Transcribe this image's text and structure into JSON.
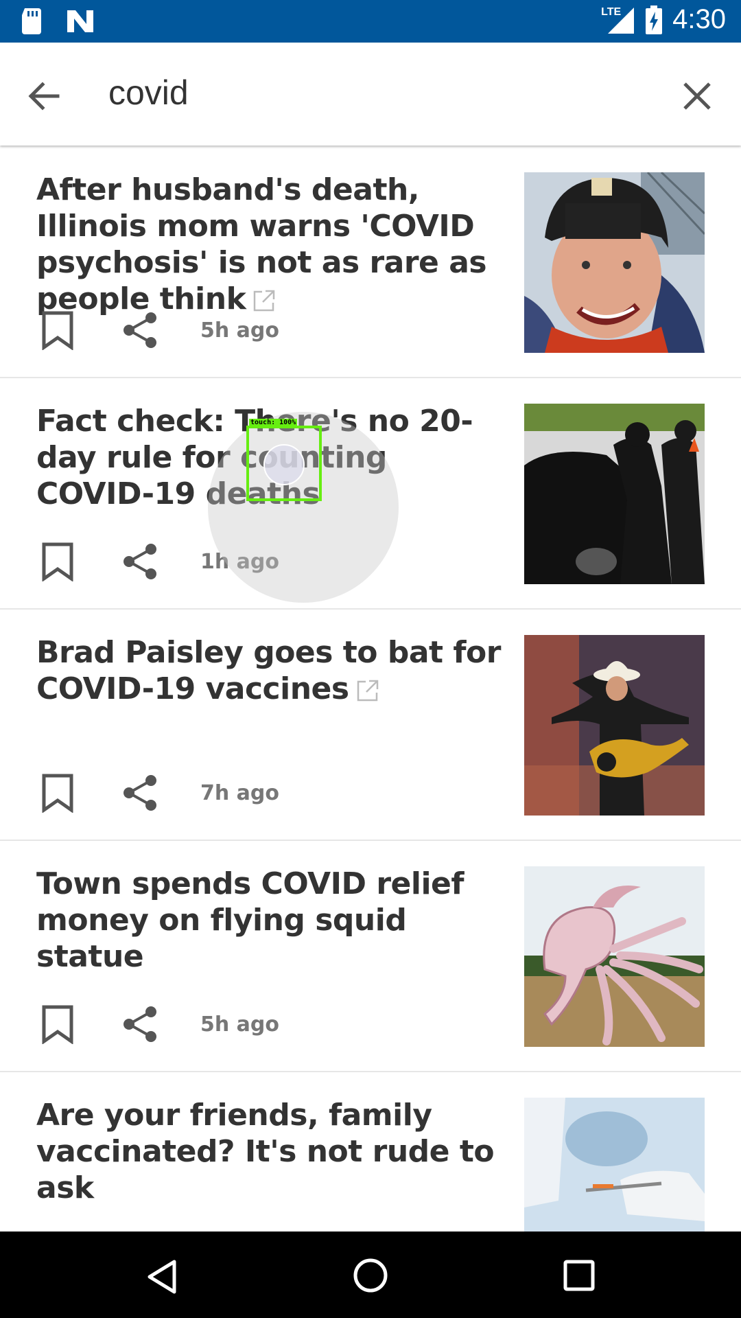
{
  "status_bar": {
    "time": "4:30",
    "network": "LTE",
    "icons": [
      "sd-card-icon",
      "n-notification-icon",
      "lte-signal-icon",
      "battery-charging-icon"
    ]
  },
  "search": {
    "query": "covid",
    "back_icon": "arrow-back-icon",
    "clear_icon": "close-icon"
  },
  "articles": [
    {
      "title": "After husband's death, Illinois mom warns 'COVID psychosis' is not as rare as people think",
      "external": true,
      "time": "5h ago",
      "thumb": "man-in-beanie-smiling"
    },
    {
      "title": "Fact check: There's no 20-day rule for counting COVID-19 deaths",
      "external": false,
      "time": "1h ago",
      "thumb": "drive-through-testing-silhouettes"
    },
    {
      "title": "Brad Paisley goes to bat for COVID-19 vaccines",
      "external": true,
      "time": "7h ago",
      "thumb": "guitarist-on-stage"
    },
    {
      "title": "Town spends COVID relief money on flying squid statue",
      "external": false,
      "time": "5h ago",
      "thumb": "squid-statue"
    },
    {
      "title": "Are your friends, family vaccinated? It's not rude to ask",
      "external": false,
      "time": "",
      "thumb": "vaccine-syringe"
    }
  ],
  "touch_indicator": {
    "label": "touch: 100%"
  },
  "colors": {
    "status_bar": "#01579b",
    "title_text": "#333333",
    "meta_text": "#777777",
    "touch_box": "#66ee11"
  }
}
